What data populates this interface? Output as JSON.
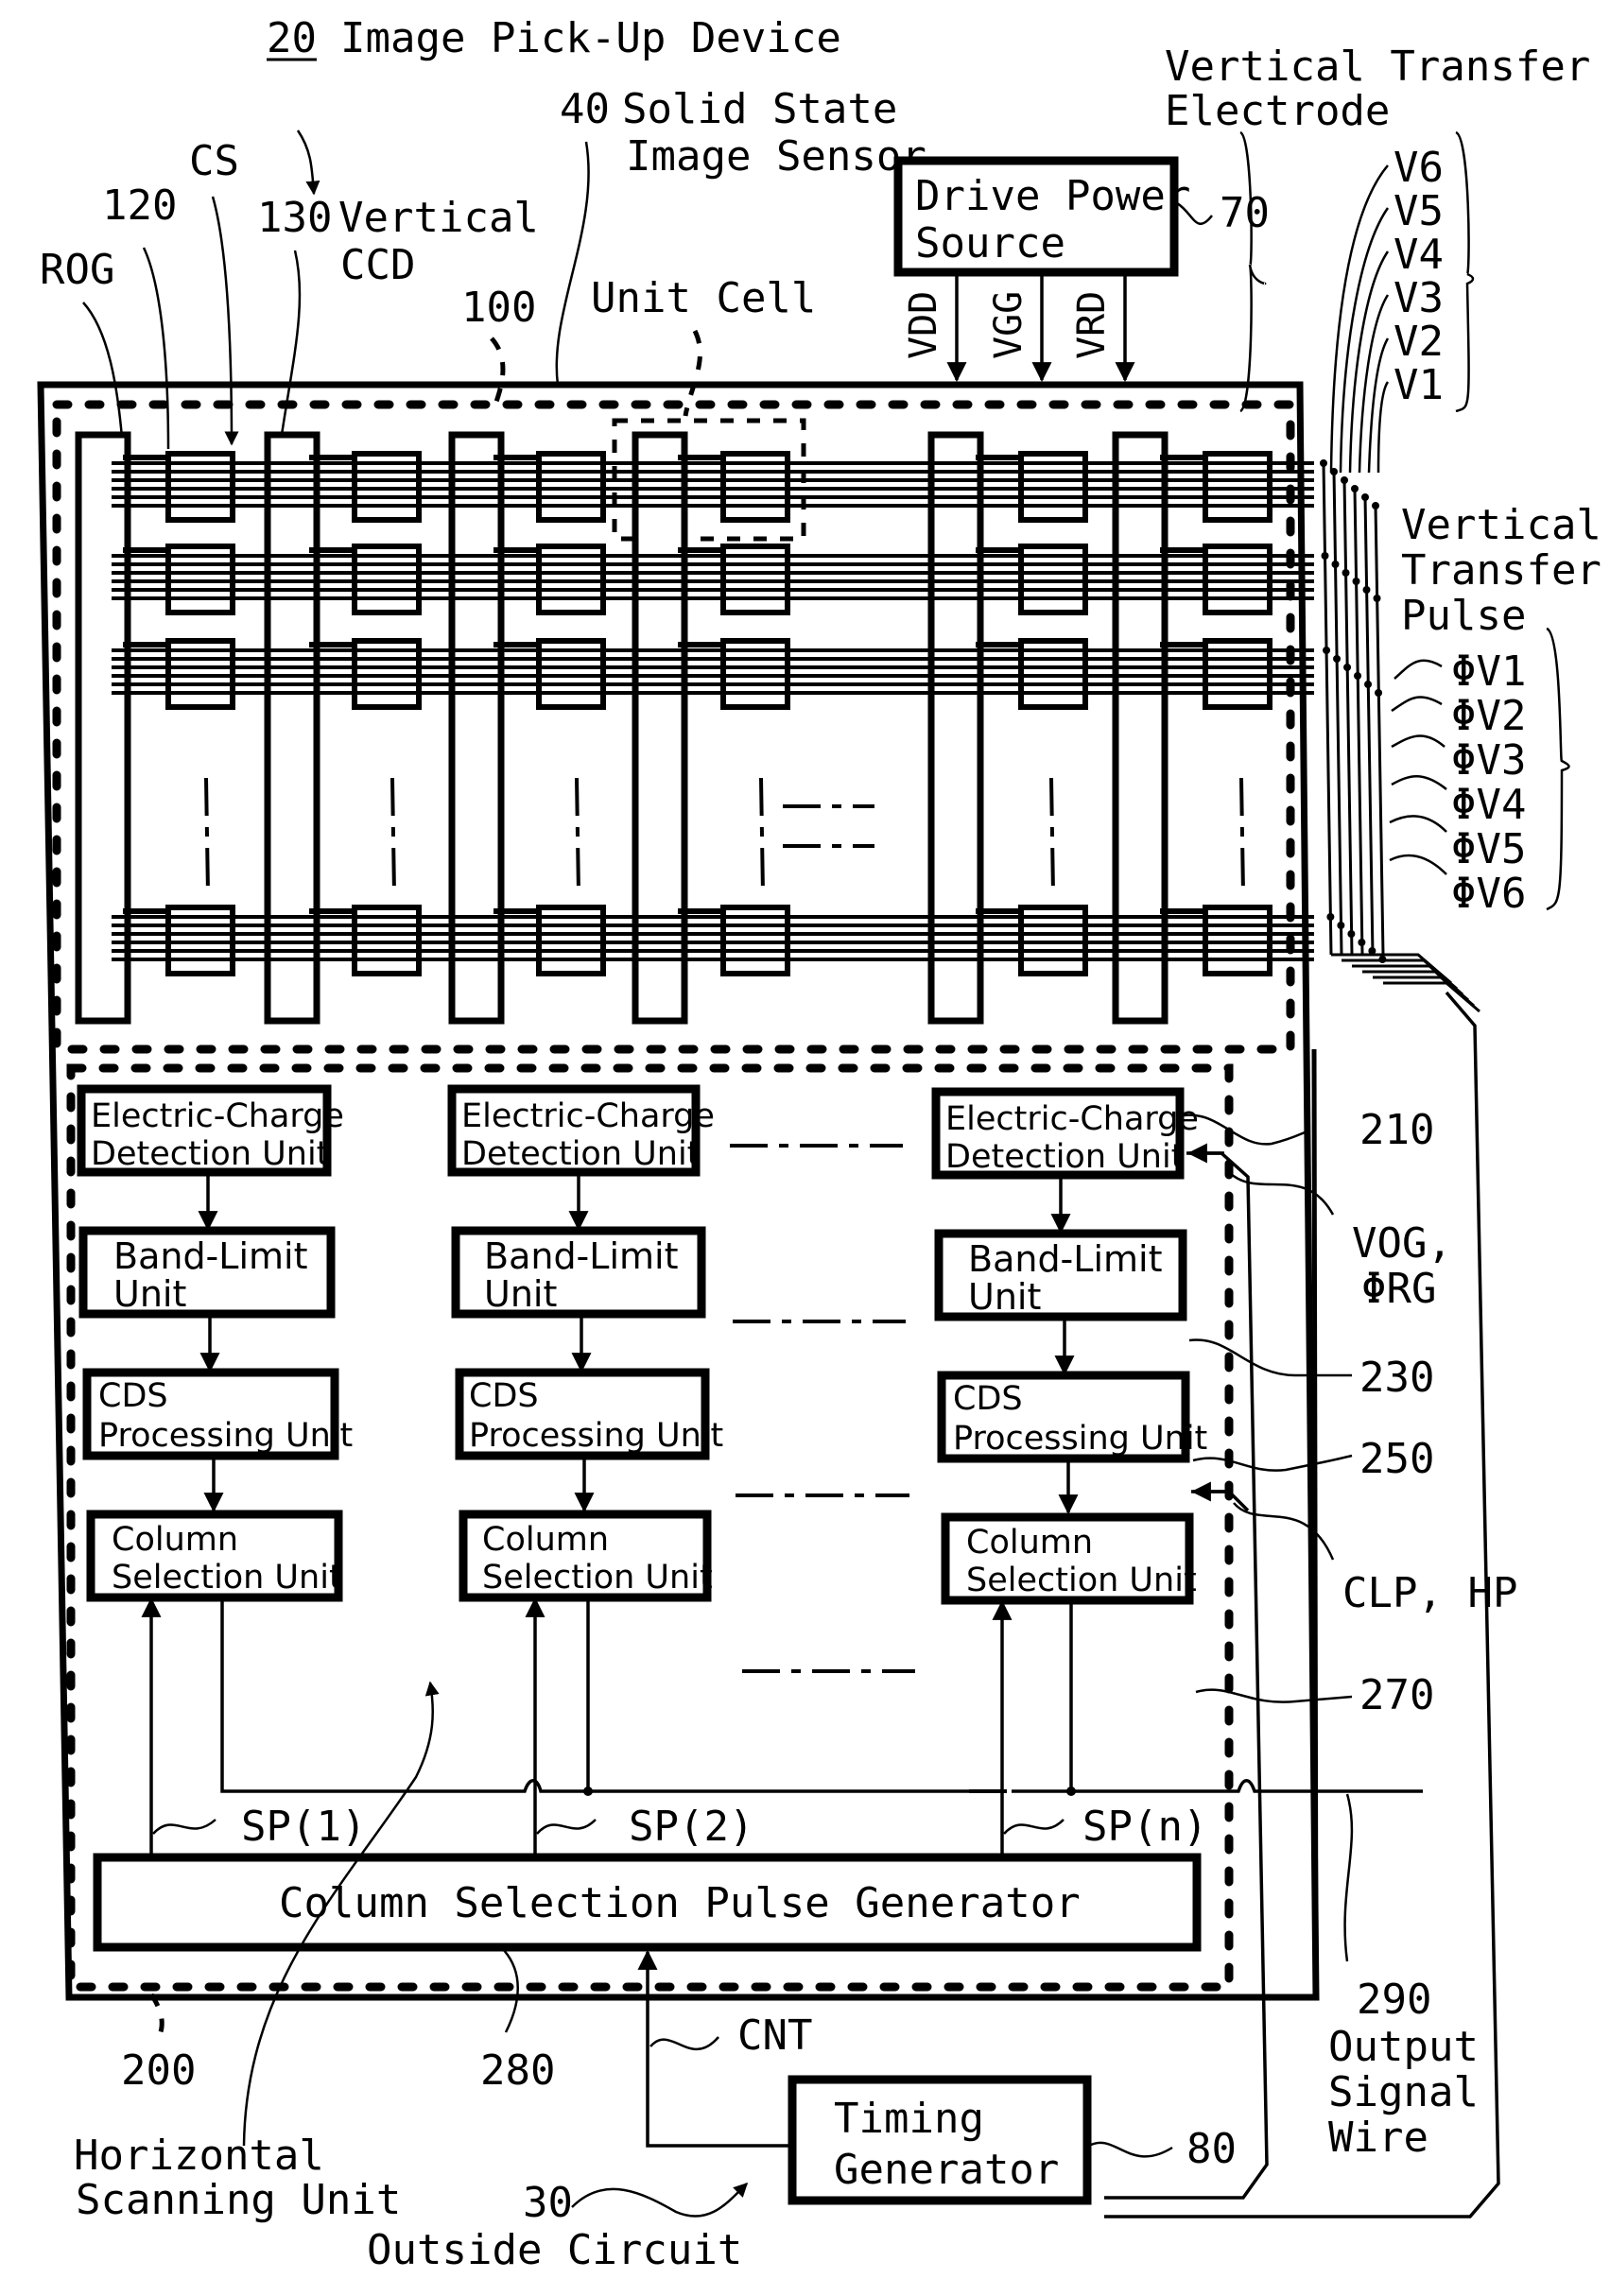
{
  "title": {
    "ref": "20",
    "text": "Image Pick-Up Device"
  },
  "labels": {
    "solid_state_sensor": {
      "ref": "40",
      "line1": "Solid State",
      "line2": "Image Sensor"
    },
    "rog": "ROG",
    "ref_120": "120",
    "cs": "CS",
    "vertical_ccd": {
      "ref": "130",
      "line1": "Vertical",
      "line2": "CCD"
    },
    "ref_100": "100",
    "unit_cell": "Unit Cell",
    "vertical_transfer_electrode": {
      "line1": "Vertical Transfer",
      "line2": "Electrode"
    },
    "electrodes": [
      "V6",
      "V5",
      "V4",
      "V3",
      "V2",
      "V1"
    ],
    "vertical_transfer_pulse": {
      "line1": "Vertical",
      "line2": "Transfer",
      "line3": "Pulse"
    },
    "pulses": [
      "ΦV1",
      "ΦV2",
      "ΦV3",
      "ΦV4",
      "ΦV5",
      "ΦV6"
    ],
    "ref_210": "210",
    "vog_rg": {
      "line1": "VOG,",
      "line2": "ΦRG"
    },
    "ref_230": "230",
    "ref_250": "250",
    "clp_hp": "CLP, HP",
    "ref_270": "270",
    "ref_290": "290",
    "output_signal_wire": {
      "line1": "Output",
      "line2": "Signal",
      "line3": "Wire"
    },
    "ref_200": "200",
    "ref_280": "280",
    "horizontal_scanning_unit": {
      "line1": "Horizontal",
      "line2": "Scanning Unit"
    },
    "outside_circuit": {
      "ref": "30",
      "text": "Outside Circuit"
    },
    "cnt": "CNT",
    "ref_80": "80",
    "ref_70": "70",
    "sp": [
      "SP(1)",
      "SP(2)",
      "SP(n)"
    ]
  },
  "drive_power_source": {
    "line1": "Drive Power",
    "line2": "Source",
    "outputs": [
      "VDD",
      "VGG",
      "VRD"
    ]
  },
  "timing_generator": {
    "line1": "Timing",
    "line2": "Generator"
  },
  "column_selection_pulse_generator": "Column Selection Pulse Generator",
  "column_blocks": {
    "charge_detection": {
      "line1": "Electric-Charge",
      "line2": "Detection Unit"
    },
    "band_limit": {
      "line1": "Band-Limit",
      "line2": "Unit"
    },
    "cds": {
      "line1": "CDS",
      "line2": "Processing Unit"
    },
    "column_selection": {
      "line1": "Column",
      "line2": "Selection Unit"
    }
  }
}
